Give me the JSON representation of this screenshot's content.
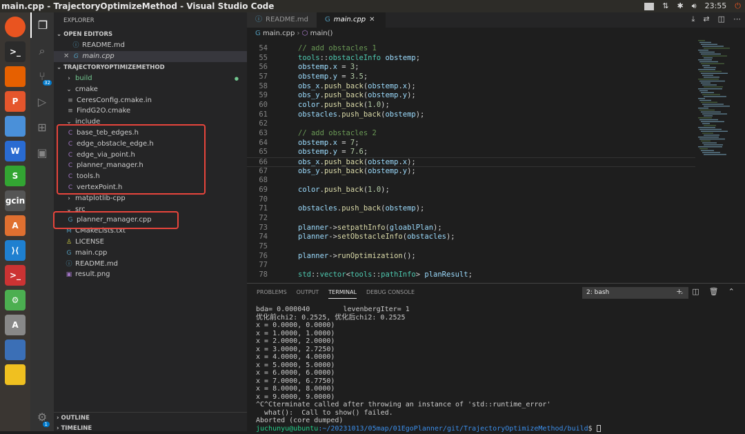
{
  "window": {
    "title": "main.cpp - TrajectoryOptimizeMethod - Visual Studio Code",
    "time": "23:55"
  },
  "launcher": [
    {
      "name": "ubuntu-icon",
      "label": ""
    },
    {
      "name": "terminal-icon",
      "label": ">_"
    },
    {
      "name": "firefox-icon",
      "label": ""
    },
    {
      "name": "impress-icon",
      "label": "P"
    },
    {
      "name": "files-icon",
      "label": ""
    },
    {
      "name": "writer-icon",
      "label": "W"
    },
    {
      "name": "calc-icon",
      "label": "S"
    },
    {
      "name": "gcin-icon",
      "label": "gcin"
    },
    {
      "name": "software-icon",
      "label": "A"
    },
    {
      "name": "vscode-icon",
      "label": "⟩⟨"
    },
    {
      "name": "terminal2-icon",
      "label": ">_"
    },
    {
      "name": "settings-icon",
      "label": "⚙"
    },
    {
      "name": "updater-icon",
      "label": "A"
    },
    {
      "name": "stack-icon",
      "label": ""
    },
    {
      "name": "pencil-icon",
      "label": ""
    }
  ],
  "activity": {
    "scm_badge": "32",
    "settings_badge": "1"
  },
  "sidebar": {
    "header": "EXPLORER",
    "open_editors": "OPEN EDITORS",
    "open_files": [
      "README.md",
      "main.cpp"
    ],
    "project": "TRAJECTORYOPTIMIZEMETHOD",
    "tree": [
      {
        "label": "build",
        "type": "folder",
        "depth": 0,
        "color": "#73c991"
      },
      {
        "label": "cmake",
        "type": "folder-open",
        "depth": 0
      },
      {
        "label": "CeresConfig.cmake.in",
        "type": "file",
        "depth": 1,
        "icon": "≡"
      },
      {
        "label": "FindG2O.cmake",
        "type": "file",
        "depth": 1,
        "icon": "≡"
      },
      {
        "label": "include",
        "type": "folder-open",
        "depth": 0
      },
      {
        "label": "base_teb_edges.h",
        "type": "file",
        "depth": 1,
        "icon": "C"
      },
      {
        "label": "edge_obstacle_edge.h",
        "type": "file",
        "depth": 1,
        "icon": "C"
      },
      {
        "label": "edge_via_point.h",
        "type": "file",
        "depth": 1,
        "icon": "C"
      },
      {
        "label": "planner_manager.h",
        "type": "file",
        "depth": 1,
        "icon": "C"
      },
      {
        "label": "tools.h",
        "type": "file",
        "depth": 1,
        "icon": "C"
      },
      {
        "label": "vertexPoint.h",
        "type": "file",
        "depth": 1,
        "icon": "C"
      },
      {
        "label": "matplotlib-cpp",
        "type": "folder",
        "depth": 0
      },
      {
        "label": "src",
        "type": "folder-open",
        "depth": 0
      },
      {
        "label": "planner_manager.cpp",
        "type": "file",
        "depth": 1,
        "icon": "G"
      },
      {
        "label": "CMakeLists.txt",
        "type": "file",
        "depth": 0,
        "icon": "M"
      },
      {
        "label": "LICENSE",
        "type": "file",
        "depth": 0,
        "icon": "♙"
      },
      {
        "label": "main.cpp",
        "type": "file",
        "depth": 0,
        "icon": "G"
      },
      {
        "label": "README.md",
        "type": "file",
        "depth": 0,
        "icon": "ⓘ"
      },
      {
        "label": "result.png",
        "type": "file",
        "depth": 0,
        "icon": "▣"
      }
    ],
    "outline": "OUTLINE",
    "timeline": "TIMELINE"
  },
  "editor": {
    "tabs": [
      "README.md",
      "main.cpp"
    ],
    "breadcrumb": [
      "main.cpp",
      "main()"
    ],
    "lines": [
      {
        "n": "54",
        "t": [
          [
            "cm",
            "// add obstacles 1"
          ]
        ]
      },
      {
        "n": "55",
        "t": [
          [
            "ty",
            "tools"
          ],
          [
            "op",
            "::"
          ],
          [
            "ty",
            "obstacleInfo"
          ],
          [
            "vr",
            " obstemp"
          ],
          [
            "op",
            ";"
          ]
        ]
      },
      {
        "n": "56",
        "t": [
          [
            "vr",
            "obstemp"
          ],
          [
            "op",
            "."
          ],
          [
            "vr",
            "x"
          ],
          [
            "op",
            " = "
          ],
          [
            "nu",
            "3"
          ],
          [
            "op",
            ";"
          ]
        ]
      },
      {
        "n": "57",
        "t": [
          [
            "vr",
            "obstemp"
          ],
          [
            "op",
            "."
          ],
          [
            "vr",
            "y"
          ],
          [
            "op",
            " = "
          ],
          [
            "nu",
            "3.5"
          ],
          [
            "op",
            ";"
          ]
        ]
      },
      {
        "n": "58",
        "t": [
          [
            "vr",
            "obs_x"
          ],
          [
            "op",
            "."
          ],
          [
            "fn",
            "push_back"
          ],
          [
            "op",
            "("
          ],
          [
            "vr",
            "obstemp"
          ],
          [
            "op",
            "."
          ],
          [
            "vr",
            "x"
          ],
          [
            "op",
            ");"
          ]
        ]
      },
      {
        "n": "59",
        "t": [
          [
            "vr",
            "obs_y"
          ],
          [
            "op",
            "."
          ],
          [
            "fn",
            "push_back"
          ],
          [
            "op",
            "("
          ],
          [
            "vr",
            "obstemp"
          ],
          [
            "op",
            "."
          ],
          [
            "vr",
            "y"
          ],
          [
            "op",
            ");"
          ]
        ]
      },
      {
        "n": "60",
        "t": [
          [
            "vr",
            "color"
          ],
          [
            "op",
            "."
          ],
          [
            "fn",
            "push_back"
          ],
          [
            "op",
            "("
          ],
          [
            "nu",
            "1.0"
          ],
          [
            "op",
            ");"
          ]
        ]
      },
      {
        "n": "61",
        "t": [
          [
            "vr",
            "obstacles"
          ],
          [
            "op",
            "."
          ],
          [
            "fn",
            "push_back"
          ],
          [
            "op",
            "("
          ],
          [
            "vr",
            "obstemp"
          ],
          [
            "op",
            ");"
          ]
        ]
      },
      {
        "n": "62",
        "t": []
      },
      {
        "n": "63",
        "t": [
          [
            "cm",
            "// add obstacles 2"
          ]
        ]
      },
      {
        "n": "64",
        "t": [
          [
            "vr",
            "obstemp"
          ],
          [
            "op",
            "."
          ],
          [
            "vr",
            "x"
          ],
          [
            "op",
            " = "
          ],
          [
            "nu",
            "7"
          ],
          [
            "op",
            ";"
          ]
        ]
      },
      {
        "n": "65",
        "t": [
          [
            "vr",
            "obstemp"
          ],
          [
            "op",
            "."
          ],
          [
            "vr",
            "y"
          ],
          [
            "op",
            " = "
          ],
          [
            "nu",
            "7.6"
          ],
          [
            "op",
            ";"
          ]
        ]
      },
      {
        "n": "66",
        "t": [
          [
            "vr",
            "obs_x"
          ],
          [
            "op",
            "."
          ],
          [
            "fn",
            "push_back"
          ],
          [
            "op",
            "("
          ],
          [
            "vr",
            "obstemp"
          ],
          [
            "op",
            "."
          ],
          [
            "vr",
            "x"
          ],
          [
            "op",
            ");"
          ]
        ]
      },
      {
        "n": "67",
        "t": [
          [
            "vr",
            "obs_y"
          ],
          [
            "op",
            "."
          ],
          [
            "fn",
            "push_back"
          ],
          [
            "op",
            "("
          ],
          [
            "vr",
            "obstemp"
          ],
          [
            "op",
            "."
          ],
          [
            "vr",
            "y"
          ],
          [
            "op",
            ");"
          ]
        ]
      },
      {
        "n": "68",
        "t": []
      },
      {
        "n": "69",
        "t": [
          [
            "vr",
            "color"
          ],
          [
            "op",
            "."
          ],
          [
            "fn",
            "push_back"
          ],
          [
            "op",
            "("
          ],
          [
            "nu",
            "1.0"
          ],
          [
            "op",
            ");"
          ]
        ]
      },
      {
        "n": "70",
        "t": []
      },
      {
        "n": "71",
        "t": [
          [
            "vr",
            "obstacles"
          ],
          [
            "op",
            "."
          ],
          [
            "fn",
            "push_back"
          ],
          [
            "op",
            "("
          ],
          [
            "vr",
            "obstemp"
          ],
          [
            "op",
            ");"
          ]
        ]
      },
      {
        "n": "72",
        "t": []
      },
      {
        "n": "73",
        "t": [
          [
            "vr",
            "planner"
          ],
          [
            "op",
            "->"
          ],
          [
            "fn",
            "setpathInfo"
          ],
          [
            "op",
            "("
          ],
          [
            "vr",
            "gloablPlan"
          ],
          [
            "op",
            ");"
          ]
        ]
      },
      {
        "n": "74",
        "t": [
          [
            "vr",
            "planner"
          ],
          [
            "op",
            "->"
          ],
          [
            "fn",
            "setObstacleInfo"
          ],
          [
            "op",
            "("
          ],
          [
            "vr",
            "obstacles"
          ],
          [
            "op",
            ");"
          ]
        ]
      },
      {
        "n": "75",
        "t": []
      },
      {
        "n": "76",
        "t": [
          [
            "vr",
            "planner"
          ],
          [
            "op",
            "->"
          ],
          [
            "fn",
            "runOptimization"
          ],
          [
            "op",
            "();"
          ]
        ]
      },
      {
        "n": "77",
        "t": []
      },
      {
        "n": "78",
        "t": [
          [
            "ty",
            "std"
          ],
          [
            "op",
            "::"
          ],
          [
            "ty",
            "vector"
          ],
          [
            "op",
            "<"
          ],
          [
            "ty",
            "tools"
          ],
          [
            "op",
            "::"
          ],
          [
            "ty",
            "pathInfo"
          ],
          [
            "op",
            "> "
          ],
          [
            "vr",
            "planResult"
          ],
          [
            "op",
            ";"
          ]
        ]
      }
    ]
  },
  "panel": {
    "tabs": [
      "PROBLEMS",
      "OUTPUT",
      "TERMINAL",
      "DEBUG CONSOLE"
    ],
    "active_tab": "TERMINAL",
    "terminal_select": "2: bash",
    "lines": [
      "bda= 0.000040        levenbergIter= 1",
      "优化前chi2: 0.2525, 优化后chi2: 0.2525",
      "x = 0.0000, 0.0000)",
      "x = 1.0000, 1.0000)",
      "x = 2.0000, 2.0000)",
      "x = 3.0000, 2.7250)",
      "x = 4.0000, 4.0000)",
      "x = 5.0000, 5.0000)",
      "x = 6.0000, 6.0000)",
      "x = 7.0000, 6.7750)",
      "x = 8.0000, 8.0000)",
      "x = 9.0000, 9.0000)",
      "^C^Cterminate called after throwing an instance of 'std::runtime_error'",
      "  what():  Call to show() failed.",
      "Aborted (core dumped)"
    ],
    "prompt_user": "juchunyu@ubuntu",
    "prompt_path": ":~/20231013/05map/01EgoPlanner/git/TrajectoryOptimizeMethod/build",
    "prompt_end": "$ "
  }
}
